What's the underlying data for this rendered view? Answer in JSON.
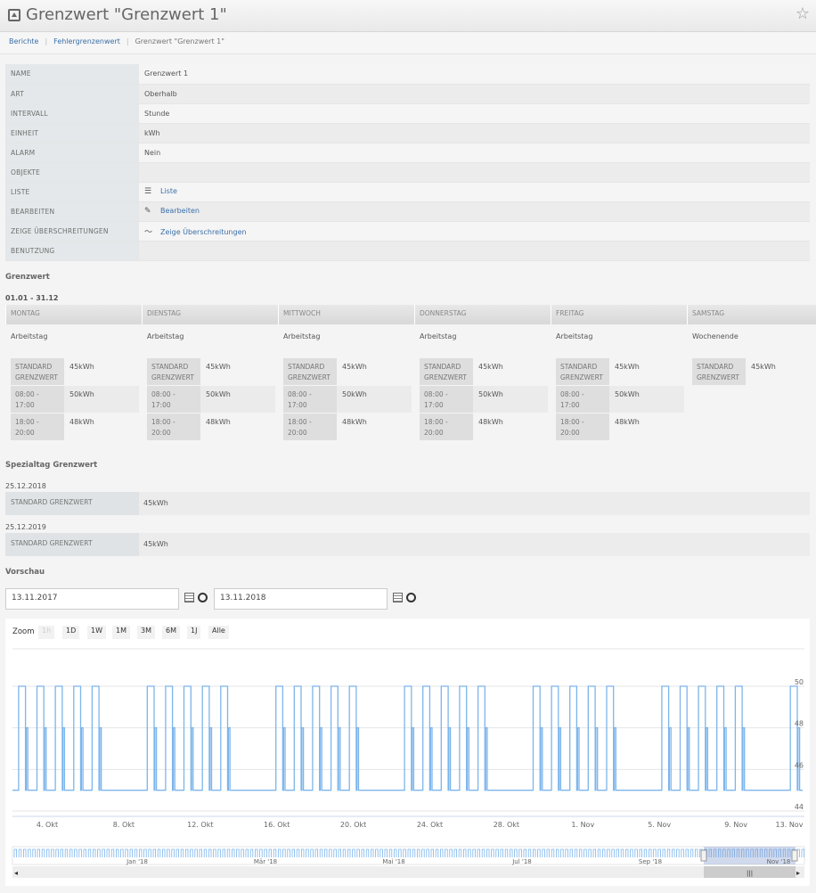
{
  "header": {
    "title": "Grenzwert \"Grenzwert 1\""
  },
  "breadcrumb": {
    "items": [
      "Berichte",
      "Fehlergrenzenwert"
    ],
    "current": "Grenzwert \"Grenzwert 1\""
  },
  "info": [
    {
      "key": "NAME",
      "value": "Grenzwert 1"
    },
    {
      "key": "ART",
      "value": "Oberhalb"
    },
    {
      "key": "INTERVALL",
      "value": "Stunde"
    },
    {
      "key": "EINHEIT",
      "value": "kWh"
    },
    {
      "key": "ALARM",
      "value": "Nein"
    },
    {
      "key": "OBJEKTE",
      "value": ""
    },
    {
      "key": "LISTE",
      "value": "Liste",
      "icon": "list-icon",
      "link": true
    },
    {
      "key": "BEARBEITEN",
      "value": "Bearbeiten",
      "icon": "edit-icon",
      "link": true
    },
    {
      "key": "ZEIGE ÜBERSCHREITUNGEN",
      "value": "Zeige Überschreitungen",
      "icon": "chart-line-icon",
      "link": true
    },
    {
      "key": "BENUTZUNG",
      "value": ""
    }
  ],
  "grenzwert": {
    "heading": "Grenzwert",
    "range": "01.01 - 31.12",
    "days": [
      {
        "name": "MONTAG",
        "type": "Arbeitstag",
        "limits": [
          {
            "label": "STANDARD GRENZWERT",
            "value": "45kWh"
          },
          {
            "label": "08:00 - 17:00",
            "value": "50kWh"
          },
          {
            "label": "18:00 - 20:00",
            "value": "48kWh"
          }
        ]
      },
      {
        "name": "DIENSTAG",
        "type": "Arbeitstag",
        "limits": [
          {
            "label": "STANDARD GRENZWERT",
            "value": "45kWh"
          },
          {
            "label": "08:00 - 17:00",
            "value": "50kWh"
          },
          {
            "label": "18:00 - 20:00",
            "value": "48kWh"
          }
        ]
      },
      {
        "name": "MITTWOCH",
        "type": "Arbeitstag",
        "limits": [
          {
            "label": "STANDARD GRENZWERT",
            "value": "45kWh"
          },
          {
            "label": "08:00 - 17:00",
            "value": "50kWh"
          },
          {
            "label": "18:00 - 20:00",
            "value": "48kWh"
          }
        ]
      },
      {
        "name": "DONNERSTAG",
        "type": "Arbeitstag",
        "limits": [
          {
            "label": "STANDARD GRENZWERT",
            "value": "45kWh"
          },
          {
            "label": "08:00 - 17:00",
            "value": "50kWh"
          },
          {
            "label": "18:00 - 20:00",
            "value": "48kWh"
          }
        ]
      },
      {
        "name": "FREITAG",
        "type": "Arbeitstag",
        "limits": [
          {
            "label": "STANDARD GRENZWERT",
            "value": "45kWh"
          },
          {
            "label": "08:00 - 17:00",
            "value": "50kWh"
          },
          {
            "label": "18:00 - 20:00",
            "value": "48kWh"
          }
        ]
      },
      {
        "name": "SAMSTAG",
        "type": "Wochenende",
        "limits": [
          {
            "label": "STANDARD GRENZWERT",
            "value": "45kWh"
          }
        ]
      }
    ]
  },
  "spezial": {
    "heading": "Spezialtag Grenzwert",
    "items": [
      {
        "date": "25.12.2018",
        "label": "STANDARD GRENZWERT",
        "value": "45kWh"
      },
      {
        "date": "25.12.2019",
        "label": "STANDARD GRENZWERT",
        "value": "45kWh"
      }
    ]
  },
  "vorschau": {
    "heading": "Vorschau",
    "from": "13.11.2017",
    "to": "13.11.2018",
    "zoom_label": "Zoom",
    "zoom_buttons": [
      "1h",
      "1D",
      "1W",
      "1M",
      "3M",
      "6M",
      "1J",
      "Alle"
    ]
  },
  "chart_data": {
    "type": "line",
    "title": "",
    "xlabel": "",
    "ylabel": "",
    "ylim": [
      44,
      50
    ],
    "yticks": [
      44,
      46,
      48,
      50
    ],
    "xticks": [
      "4. Okt",
      "8. Okt",
      "12. Okt",
      "16. Okt",
      "20. Okt",
      "24. Okt",
      "28. Okt",
      "1. Nov",
      "5. Nov",
      "9. Nov",
      "13. Nov"
    ],
    "x_range": [
      "2018-10-01",
      "2018-11-13"
    ],
    "weekday_pattern": [
      {
        "from": "00:00",
        "to": "08:00",
        "value": 45
      },
      {
        "from": "08:00",
        "to": "17:00",
        "value": 50
      },
      {
        "from": "17:00",
        "to": "18:00",
        "value": 45
      },
      {
        "from": "18:00",
        "to": "20:00",
        "value": 48
      },
      {
        "from": "20:00",
        "to": "24:00",
        "value": 45
      }
    ],
    "weekend_value": 45,
    "navigator_labels": [
      "Jan '18",
      "Mär '18",
      "Mai '18",
      "Jul '18",
      "Sep '18",
      "Nov '18"
    ]
  }
}
